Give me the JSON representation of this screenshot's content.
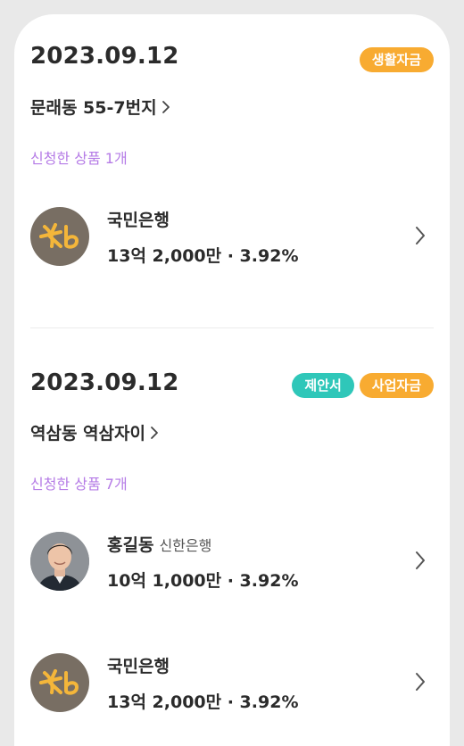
{
  "applications": [
    {
      "date": "2023.09.12",
      "badges": [
        {
          "label": "생활자금",
          "color": "#f8ab31"
        }
      ],
      "address": "문래동 55-7번지",
      "product_count": "신청한 상품 1개",
      "products": [
        {
          "name": "국민은행",
          "sub": "",
          "detail": "13억 2,000만 · 3.92%",
          "avatar": "kb-logo"
        }
      ]
    },
    {
      "date": "2023.09.12",
      "badges": [
        {
          "label": "제안서",
          "color": "#2fc7b9"
        },
        {
          "label": "사업자금",
          "color": "#f8ab31"
        }
      ],
      "address": "역삼동 역삼자이",
      "product_count": "신청한 상품 7개",
      "products": [
        {
          "name": "홍길동",
          "sub": "신한은행",
          "detail": "10억 1,000만 · 3.92%",
          "avatar": "person-photo"
        },
        {
          "name": "국민은행",
          "sub": "",
          "detail": "13억 2,000만 · 3.92%",
          "avatar": "kb-logo"
        }
      ]
    }
  ]
}
